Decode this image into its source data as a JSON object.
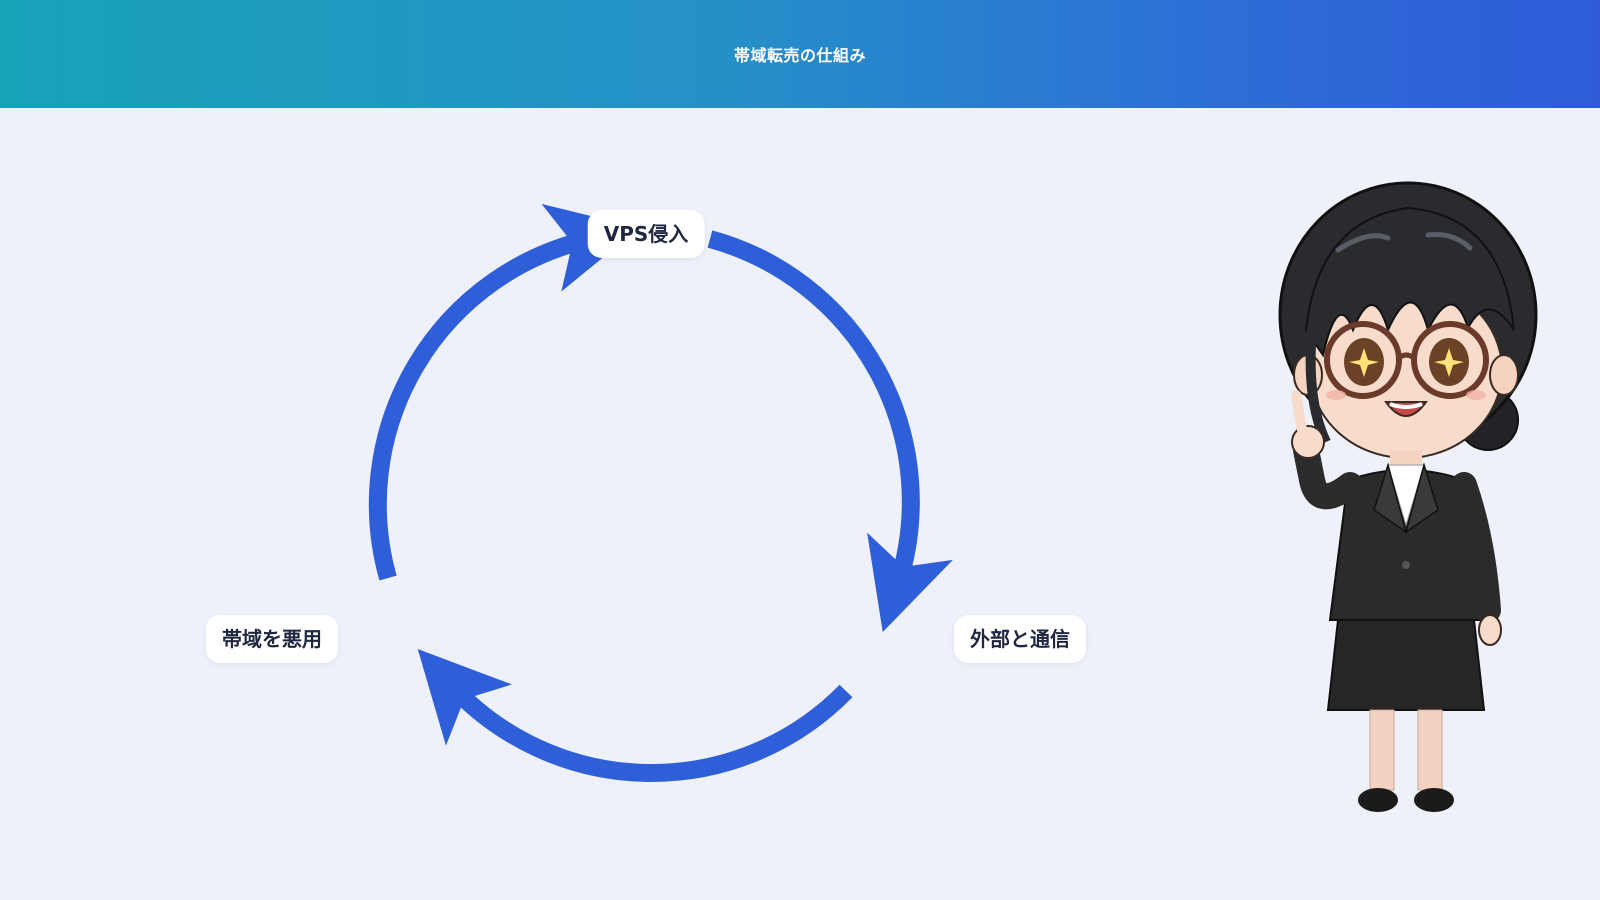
{
  "header": {
    "title": "帯域転売の仕組み"
  },
  "diagram": {
    "type": "cycle",
    "nodes": [
      {
        "id": "vps",
        "label": "VPS侵入"
      },
      {
        "id": "external",
        "label": "外部と通信"
      },
      {
        "id": "abuse",
        "label": "帯域を悪用"
      }
    ],
    "flow": [
      "VPS侵入",
      "外部と通信",
      "帯域を悪用",
      "VPS侵入"
    ],
    "arrow_color": "#2f5fd8"
  },
  "mascot": {
    "icon": "businesswoman-mascot-icon"
  },
  "colors": {
    "background": "#eef1f9",
    "header_start": "#18a2b8",
    "header_end": "#2f5bd9",
    "node_bg": "#ffffff",
    "node_text": "#1e2640"
  }
}
